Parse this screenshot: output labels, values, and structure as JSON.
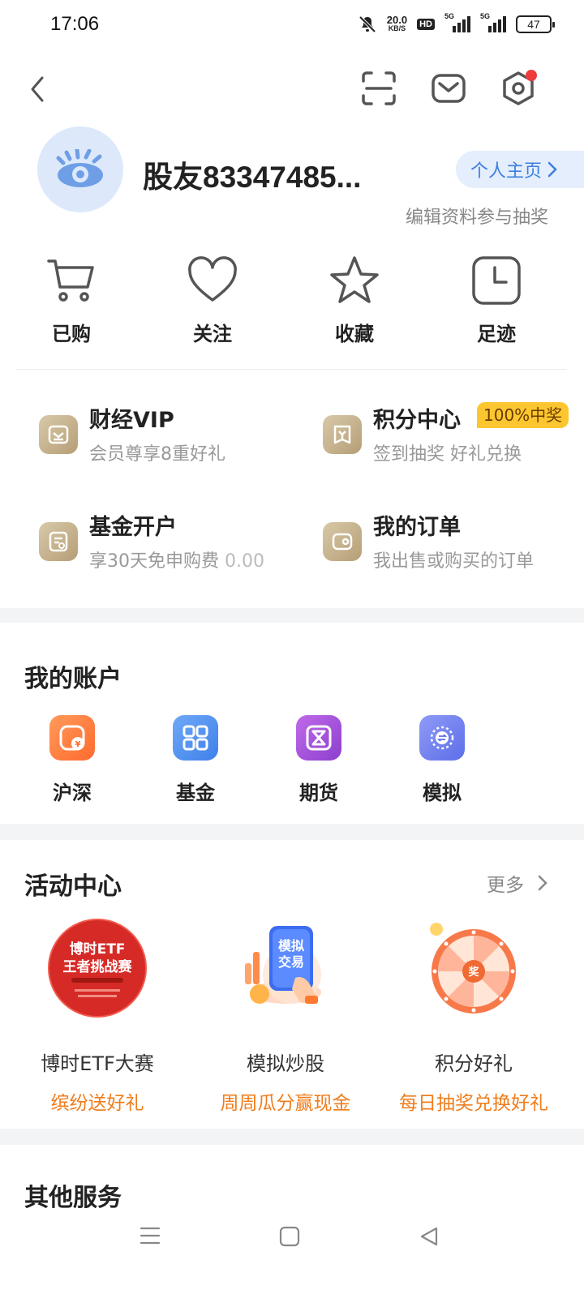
{
  "status_bar": {
    "time": "17:06",
    "net_speed": "20.0",
    "net_unit": "KB/S",
    "hd": "HD",
    "signal1": "5G",
    "signal2": "5G",
    "battery": "47",
    "icons": [
      "mute-icon",
      "hd-icon",
      "signal-icon",
      "battery-icon"
    ]
  },
  "header": {
    "icons": [
      "back-icon",
      "scan-icon",
      "mail-icon",
      "settings-icon"
    ],
    "accent": "#ef3b3b"
  },
  "profile": {
    "username": "股友83347485...",
    "home_button": "个人主页",
    "edit_tip": "编辑资料参与抽奖"
  },
  "quick_actions": [
    {
      "label": "已购",
      "icon": "cart-icon"
    },
    {
      "label": "关注",
      "icon": "heart-icon"
    },
    {
      "label": "收藏",
      "icon": "star-icon"
    },
    {
      "label": "足迹",
      "icon": "clock-icon"
    }
  ],
  "features": [
    {
      "title": "财经VIP",
      "subtitle": "会员尊享8重好礼",
      "icon": "vip-icon"
    },
    {
      "title": "积分中心",
      "subtitle": "签到抽奖 好礼兑换",
      "badge": "100%中奖",
      "icon": "points-icon"
    },
    {
      "title": "基金开户",
      "subtitle": "享30天免申购费",
      "subtitle_value": "0.00",
      "icon": "fund-doc-icon"
    },
    {
      "title": "我的订单",
      "subtitle": "我出售或购买的订单",
      "icon": "wallet-icon"
    }
  ],
  "accounts": {
    "title": "我的账户",
    "items": [
      {
        "label": "沪深",
        "icon": "stock-icon",
        "color": "#ff7a3d"
      },
      {
        "label": "基金",
        "icon": "fund-icon",
        "color": "#4b8df3"
      },
      {
        "label": "期货",
        "icon": "futures-icon",
        "color": "#9d4fd6"
      },
      {
        "label": "模拟",
        "icon": "simulate-icon",
        "color": "#6b7cf0"
      }
    ]
  },
  "activities": {
    "title": "活动中心",
    "more": "更多",
    "items": [
      {
        "title": "博时ETF大赛",
        "subtitle": "缤纷送好礼",
        "image_text_1": "博时ETF",
        "image_text_2": "王者挑战赛"
      },
      {
        "title": "模拟炒股",
        "subtitle": "周周瓜分赢现金",
        "image_text_1": "模拟",
        "image_text_2": "交易"
      },
      {
        "title": "积分好礼",
        "subtitle": "每日抽奖兑换好礼",
        "image_text_1": "奖"
      }
    ]
  },
  "other_services": {
    "title": "其他服务"
  },
  "bottom_nav": {
    "icons": [
      "menu-icon",
      "home-square-icon",
      "back-triangle-icon"
    ]
  }
}
